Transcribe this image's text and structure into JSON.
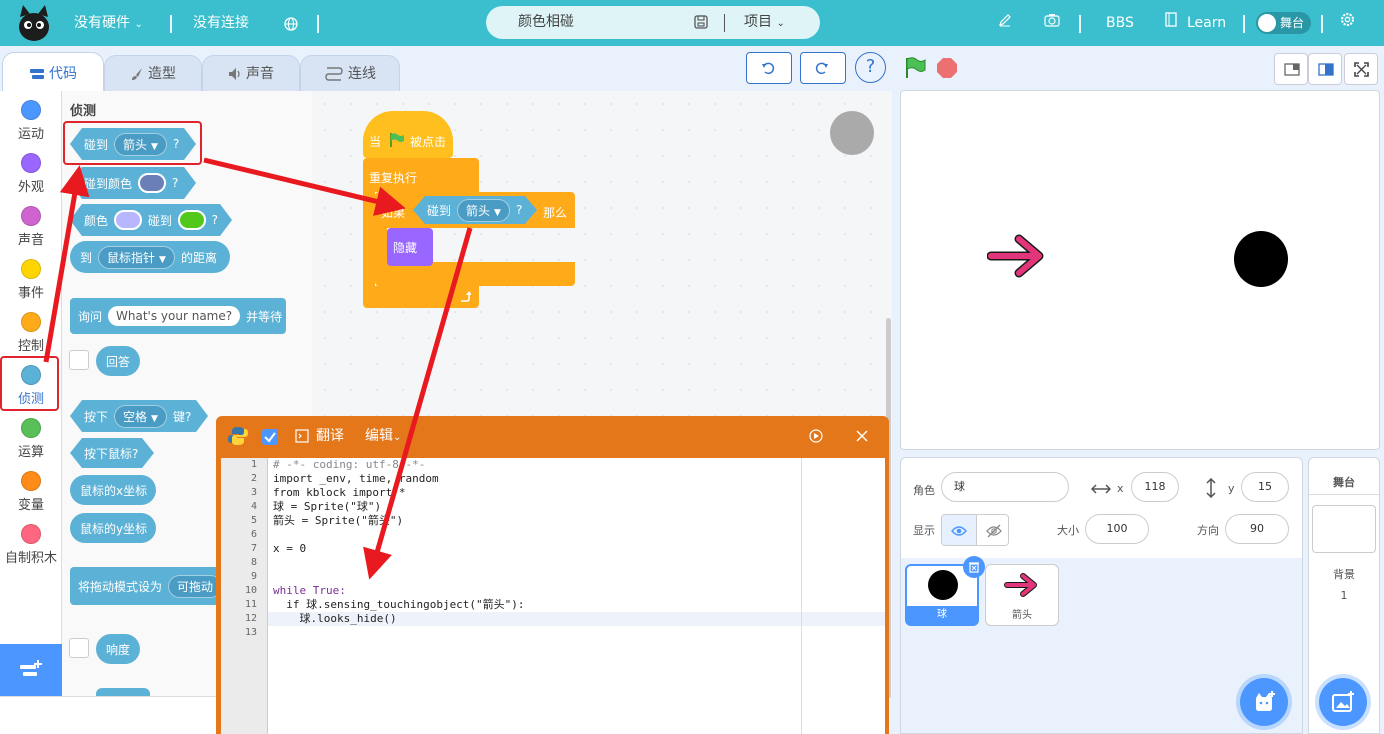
{
  "topbar": {
    "hardware": "没有硬件",
    "connection": "没有连接",
    "project_title": "颜色相碰",
    "project_menu": "项目",
    "bbs": "BBS",
    "learn": "Learn",
    "stage_toggle": "舞台"
  },
  "tabs": [
    "代码",
    "造型",
    "声音",
    "连线"
  ],
  "categories": [
    {
      "label": "运动",
      "color": "#4c97ff"
    },
    {
      "label": "外观",
      "color": "#9966ff"
    },
    {
      "label": "声音",
      "color": "#cf63cf"
    },
    {
      "label": "事件",
      "color": "#ffd500"
    },
    {
      "label": "控制",
      "color": "#ffab19"
    },
    {
      "label": "侦测",
      "color": "#5cb1d6"
    },
    {
      "label": "运算",
      "color": "#59c059"
    },
    {
      "label": "变量",
      "color": "#ff8c1a"
    },
    {
      "label": "自制积木",
      "color": "#ff6680"
    }
  ],
  "palette": {
    "section": "侦测",
    "touching": {
      "text": "碰到",
      "menu": "箭头",
      "q": "?"
    },
    "touching_color": {
      "text": "碰到颜色",
      "q": "?",
      "swatch": "#6a7fb8"
    },
    "color_touch": {
      "a": "颜色",
      "b": "碰到",
      "q": "?",
      "c1": "#b7b6ff",
      "c2": "#52c81a"
    },
    "distance": {
      "a": "到",
      "menu": "鼠标指针",
      "b": "的距离"
    },
    "ask": {
      "a": "询问",
      "input": "What's your name?",
      "b": "并等待"
    },
    "answer": "回答",
    "keypress": {
      "a": "按下",
      "menu": "空格",
      "b": "键?"
    },
    "mouse_down": "按下鼠标?",
    "mouse_x": "鼠标的x坐标",
    "mouse_y": "鼠标的y坐标",
    "drag_mode": {
      "a": "将拖动模式设为",
      "menu": "可拖动"
    },
    "loudness": "响度"
  },
  "script": {
    "hat": {
      "a": "当",
      "b": "被点击"
    },
    "forever": "重复执行",
    "if_then": {
      "a": "如果",
      "b": "碰到",
      "menu": "箭头",
      "q": "?",
      "c": "那么"
    },
    "hide": "隐藏"
  },
  "code_dialog": {
    "translate": "翻译",
    "edit": "编辑",
    "lines": [
      {
        "n": "1",
        "t": "# -*- coding: utf-8 -*-"
      },
      {
        "n": "2",
        "t": "import _env, time, random"
      },
      {
        "n": "3",
        "t": "from kblock import *"
      },
      {
        "n": "4",
        "t": "球 = Sprite(\"球\")"
      },
      {
        "n": "5",
        "t": "箭头 = Sprite(\"箭头\")"
      },
      {
        "n": "6",
        "t": ""
      },
      {
        "n": "7",
        "t": "x = 0"
      },
      {
        "n": "8",
        "t": ""
      },
      {
        "n": "9",
        "t": ""
      },
      {
        "n": "10",
        "t": "while True:"
      },
      {
        "n": "11",
        "t": "  if 球.sensing_touchingobject(\"箭头\"):"
      },
      {
        "n": "12",
        "t": "    球.looks_hide()"
      },
      {
        "n": "13",
        "t": ""
      }
    ]
  },
  "sprite_info": {
    "sprite_label": "角色",
    "sprite_name": "球",
    "x_label": "x",
    "x": "118",
    "y_label": "y",
    "y": "15",
    "show_label": "显示",
    "size_label": "大小",
    "size": "100",
    "direction_label": "方向",
    "direction": "90"
  },
  "sprites": [
    {
      "name": "球",
      "selected": true
    },
    {
      "name": "箭头",
      "selected": false
    }
  ],
  "backdrop": {
    "title": "舞台",
    "label": "背景",
    "count": "1"
  }
}
